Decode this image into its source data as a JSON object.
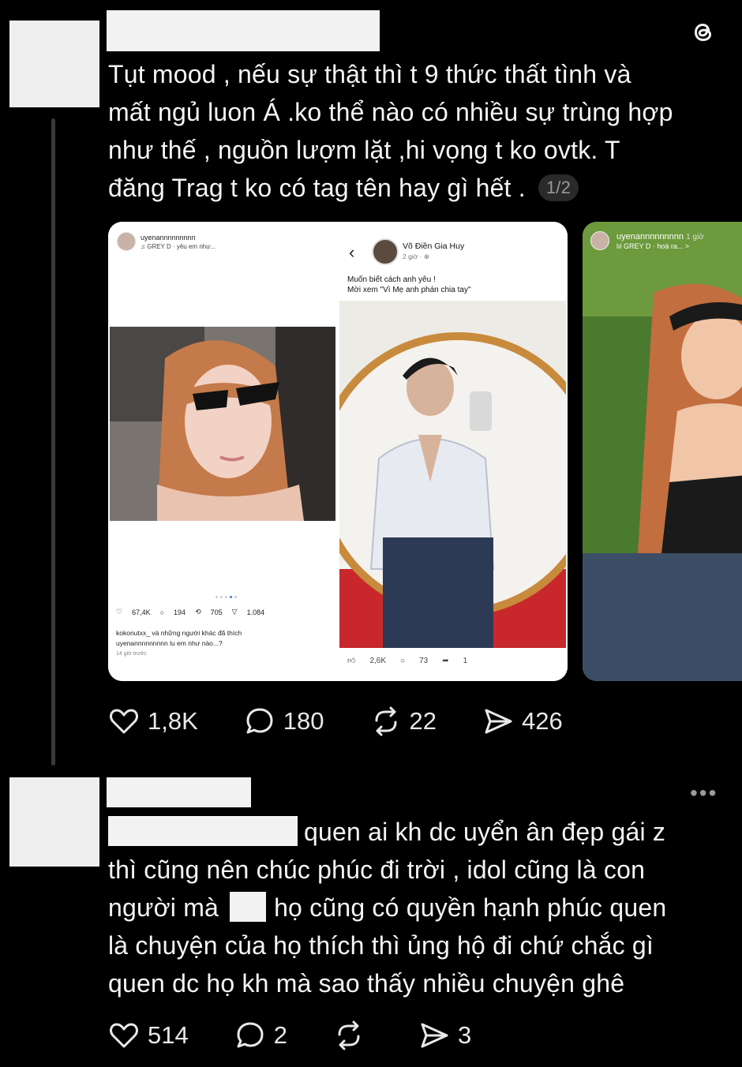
{
  "post1": {
    "lines": [
      "Tụt mood , nếu sự thật thì t 9 thức thất tình và",
      "mất ngủ  luon Á .ko thể nào có nhiều sự trùng hợp",
      "như thế , nguồn lượm lặt ,hi  vọng t ko ovtk. T",
      "đăng Trag t ko có tag tên hay gì hết ."
    ],
    "pager": "1/2",
    "likes": "1,8K",
    "replies": "180",
    "reposts": "22",
    "shares": "426"
  },
  "media": {
    "ig": {
      "username": "uyenannnnnnnnn",
      "song": "♫ GREY D · yêu em như...",
      "likes": "67,4K",
      "comments": "194",
      "reposts": "705",
      "shares": "1.084",
      "liked_by": "kokonutxx_ và những người khác đã thích",
      "caption": "uyenannnnnnnnn lu em như nào...?",
      "time": "14 giờ trước"
    },
    "fb": {
      "name": "Võ Điền Gia Huy",
      "time": "2 giờ · ⊕",
      "caption_1": "Muốn biết cách anh yêu !",
      "caption_2": "Mời xem \"Vì Mẹ anh phán chia tay\"",
      "likes": "2,6K",
      "comments": "73",
      "shares": "1"
    },
    "story": {
      "username": "uyenannnnnnnnn",
      "time": "1 giờ",
      "song": "lıl GREY D · hoá ra... >"
    }
  },
  "post2": {
    "line1_suffix": "quen ai kh dc uyển ân đẹp gái z",
    "line2": "thì cũng nên chúc phúc đi trời , idol cũng là con",
    "line3_prefix": "người mà",
    "line3_suffix": "họ cũng có quyền hạnh phúc quen",
    "line4": "là chuyện của họ thích thì ủng hộ đi chứ chắc gì",
    "line5": "quen dc họ kh mà sao thấy nhiều chuyện ghê",
    "likes": "514",
    "replies": "2",
    "reposts": "",
    "shares": "3",
    "more": "•••"
  },
  "icons": {
    "app_logo": "threads-icon",
    "like": "heart-icon",
    "reply": "comment-icon",
    "repost": "repost-icon",
    "share": "send-icon"
  }
}
